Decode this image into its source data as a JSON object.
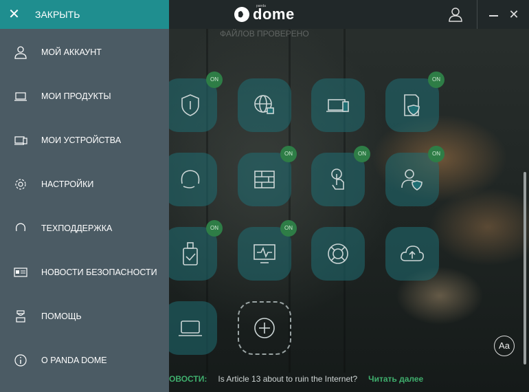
{
  "topbar": {
    "close_label": "ЗАКРЫТЬ",
    "close_icon": "close-x",
    "logo_text": "dome",
    "logo_brand": "panda",
    "user_icon": "user-icon",
    "accent_color": "#1f8e8f"
  },
  "background_text": "ФАЙЛОВ ПРОВЕРЕНО",
  "menu": {
    "items": [
      {
        "label": "МОЙ АККАУНТ",
        "icon": "user-icon"
      },
      {
        "label": "МОИ ПРОДУКТЫ",
        "icon": "laptop-icon"
      },
      {
        "label": "МОИ УСТРОЙСТВА",
        "icon": "devices-icon"
      },
      {
        "label": "НАСТРОЙКИ",
        "icon": "gear-icon"
      },
      {
        "label": "ТЕХПОДДЕРЖКА",
        "icon": "headset-icon"
      },
      {
        "label": "НОВОСТИ БЕЗОПАСНОСТИ",
        "icon": "news-icon"
      },
      {
        "label": "ПОМОЩЬ",
        "icon": "help-icon"
      },
      {
        "label": "О PANDA DOME",
        "icon": "info-icon"
      }
    ]
  },
  "tiles": {
    "on_badge": "ON",
    "items": [
      {
        "name": "antivirus",
        "icon": "shield-icon",
        "on": true
      },
      {
        "name": "web-protection",
        "icon": "globe-lock-icon",
        "on": false
      },
      {
        "name": "devices",
        "icon": "laptop-phone-icon",
        "on": false
      },
      {
        "name": "data-shield",
        "icon": "document-shield-icon",
        "on": true
      },
      {
        "name": "support",
        "icon": "headset-icon",
        "on": false
      },
      {
        "name": "firewall",
        "icon": "firewall-icon",
        "on": true
      },
      {
        "name": "wifi-protection",
        "icon": "hand-touch-icon",
        "on": true
      },
      {
        "name": "parental-control",
        "icon": "user-shield-icon",
        "on": true
      },
      {
        "name": "usb-protection",
        "icon": "usb-check-icon",
        "on": true
      },
      {
        "name": "process-monitor",
        "icon": "monitor-pulse-icon",
        "on": true
      },
      {
        "name": "rescue-kit",
        "icon": "lifebuoy-icon",
        "on": false
      },
      {
        "name": "cloud-backup",
        "icon": "cloud-upload-icon",
        "on": false
      },
      {
        "name": "vpn",
        "icon": "laptop-icon",
        "on": false
      },
      {
        "name": "add",
        "icon": "plus-circle-icon",
        "on": false
      }
    ]
  },
  "font_size_button": "Aa",
  "news": {
    "label": "ОВОСТИ:",
    "title": "Is Article 13 about to ruin the Internet?",
    "more": "Читать далее"
  }
}
